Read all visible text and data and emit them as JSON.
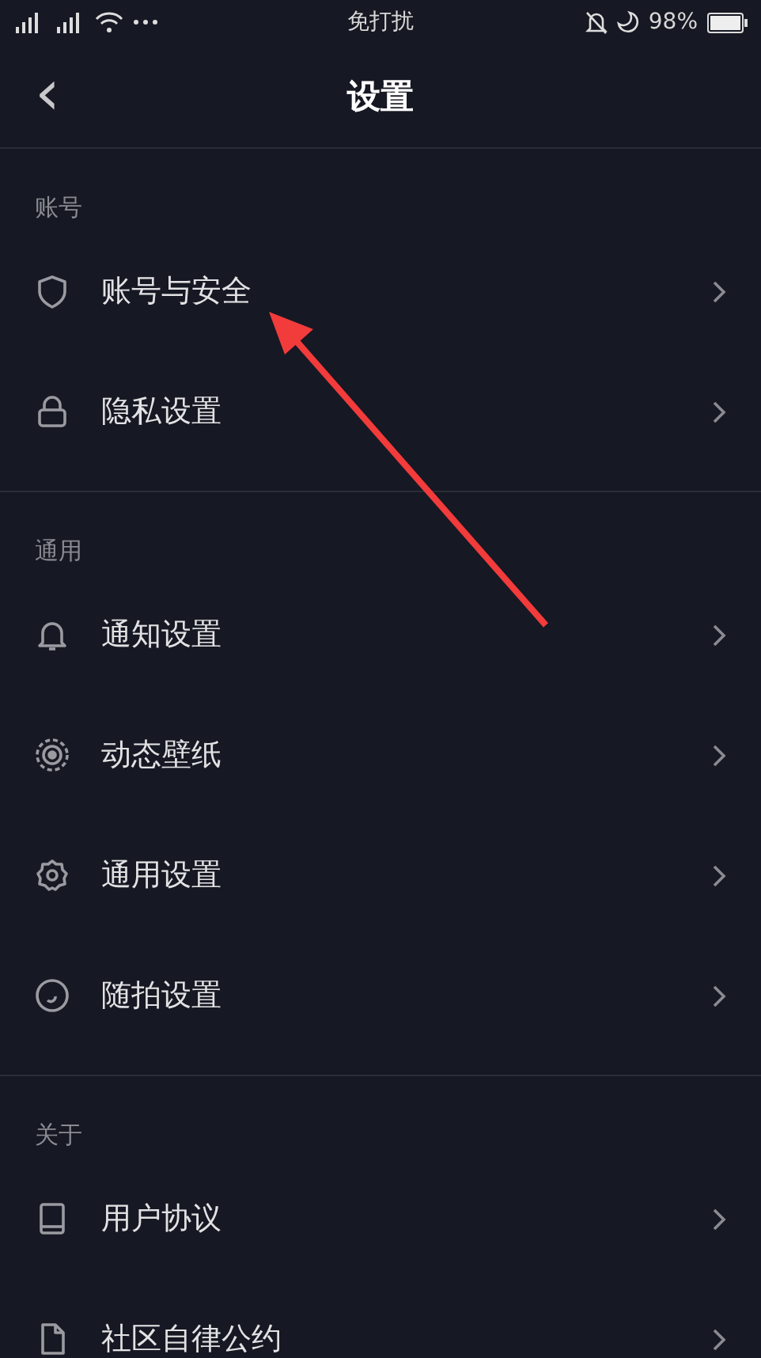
{
  "status_bar": {
    "center_text": "免打扰",
    "battery_text": "98%"
  },
  "header": {
    "back_icon": "‹",
    "title": "设置"
  },
  "sections": [
    {
      "label": "账号",
      "items": [
        {
          "label": "账号与安全",
          "kind": "shield"
        },
        {
          "label": "隐私设置",
          "kind": "lock"
        }
      ]
    },
    {
      "label": "通用",
      "items": [
        {
          "label": "通知设置",
          "kind": "bell"
        },
        {
          "label": "动态壁纸",
          "kind": "wallpaper"
        },
        {
          "label": "通用设置",
          "kind": "gear"
        },
        {
          "label": "随拍设置",
          "kind": "circle"
        }
      ]
    },
    {
      "label": "关于",
      "items": [
        {
          "label": "用户协议",
          "kind": "book"
        },
        {
          "label": "社区自律公约",
          "kind": "document"
        }
      ]
    }
  ]
}
